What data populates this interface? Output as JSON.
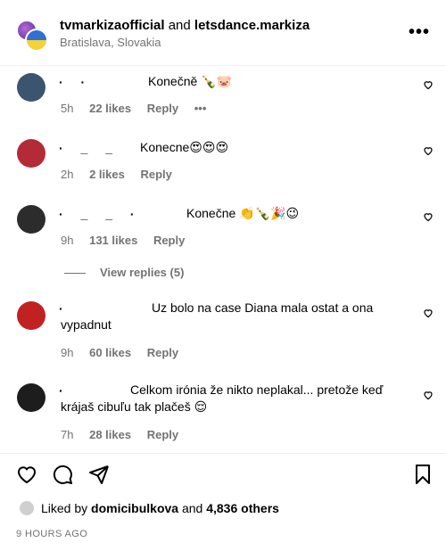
{
  "header": {
    "account1": "tvmarkizaofficial",
    "joiner": "and",
    "account2": "letsdance.markiza",
    "location": "Bratislava, Slovakia",
    "more": "•••"
  },
  "comments": [
    {
      "user": "· ·",
      "text": "Konečně 🍾🐷",
      "time": "5h",
      "likes": "22 likes",
      "reply": "Reply",
      "more": "•••",
      "avatar_color": "#3b5570"
    },
    {
      "user": "· _ _",
      "text": "Konecne😍😍😍",
      "time": "2h",
      "likes": "2 likes",
      "reply": "Reply",
      "avatar_color": "#b32b36"
    },
    {
      "user": "· _ _ ·",
      "text": "Konečne 👏🍾🎉😉",
      "time": "9h",
      "likes": "131 likes",
      "reply": "Reply",
      "avatar_color": "#2c2c2c"
    },
    {
      "user": "·",
      "text": "Uz bolo na case Diana mala ostat a ona vypadnut",
      "time": "9h",
      "likes": "60 likes",
      "reply": "Reply",
      "avatar_color": "#c22121"
    },
    {
      "user": "·",
      "text": "Celkom irónia že nikto neplakal... pretože keď krájaš cibuľu tak plačeš 😌",
      "time": "7h",
      "likes": "28 likes",
      "reply": "Reply",
      "avatar_color": "#1d1d1d"
    }
  ],
  "view_replies": "View replies (5)",
  "liked_by": {
    "prefix": "Liked by",
    "user": "domicibulkova",
    "joiner": "and",
    "count": "4,836 others"
  },
  "timestamp": "9 HOURS AGO"
}
